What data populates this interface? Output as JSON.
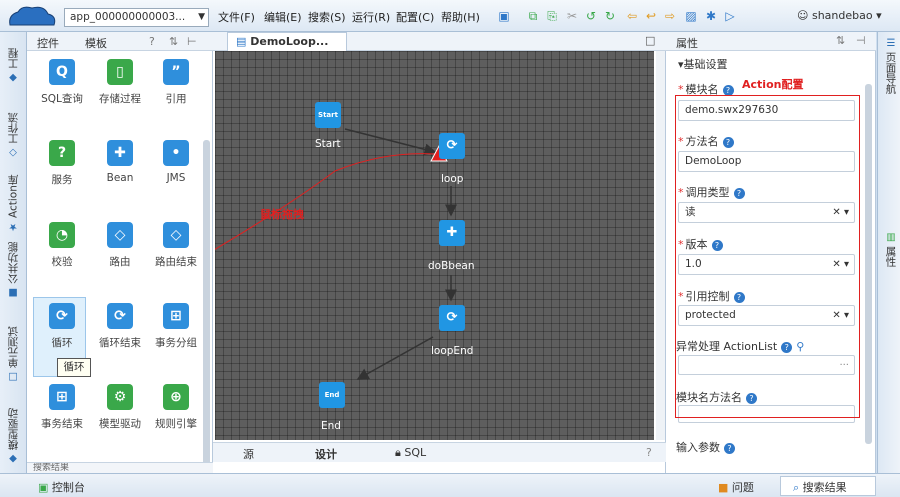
{
  "toolbar": {
    "app_select": "app_000000000003...",
    "menus": [
      "文件(F)",
      "编辑(E)",
      "搜索(S)",
      "运行(R)",
      "配置(C)",
      "帮助(H)"
    ],
    "user": "shandebao"
  },
  "left_strip": {
    "tabs": [
      "工程",
      "工作流",
      "Action库",
      "公共功能",
      "单元测试",
      "模型驱动"
    ]
  },
  "palette": {
    "tabs": [
      "控件",
      "模板"
    ],
    "items": [
      {
        "label": "SQL查询",
        "color": "#2f8fdc",
        "icon": "search-icon"
      },
      {
        "label": "存储过程",
        "color": "#3aa84a",
        "icon": "procedure-icon"
      },
      {
        "label": "引用",
        "color": "#2f8fdc",
        "icon": "quote-icon"
      },
      {
        "label": "服务",
        "color": "#3aa84a",
        "icon": "question-icon"
      },
      {
        "label": "Bean",
        "color": "#2f8fdc",
        "icon": "puzzle-icon"
      },
      {
        "label": "JMS",
        "color": "#2f8fdc",
        "icon": "chat-icon"
      },
      {
        "label": "校验",
        "color": "#3aa84a",
        "icon": "pie-icon"
      },
      {
        "label": "路由",
        "color": "#2f8fdc",
        "icon": "diamond-icon"
      },
      {
        "label": "路由结束",
        "color": "#2f8fdc",
        "icon": "diamond-end-icon"
      },
      {
        "label": "循环",
        "color": "#2f8fdc",
        "icon": "loop-icon"
      },
      {
        "label": "循环结束",
        "color": "#2f8fdc",
        "icon": "loop-end-icon"
      },
      {
        "label": "事务分组",
        "color": "#2f8fdc",
        "icon": "grid-icon"
      },
      {
        "label": "事务结束",
        "color": "#2f8fdc",
        "icon": "grid-end-icon"
      },
      {
        "label": "模型驱动",
        "color": "#3aa84a",
        "icon": "gear-icon"
      },
      {
        "label": "规则引擎",
        "color": "#3aa84a",
        "icon": "rule-icon"
      }
    ],
    "tooltip": "循环",
    "search_results_label": "搜索结果"
  },
  "editor": {
    "tab_title": "DemoLoop...",
    "bottom_tabs": [
      "源",
      "设计",
      "SQL"
    ],
    "nodes": {
      "start_icon": "Start",
      "start_label": "Start",
      "loop_label": "loop",
      "dobbean_label": "doBbean",
      "loopend_label": "loopEnd",
      "end_icon": "End",
      "end_label": "End"
    },
    "annotation": "鼠标拖拽"
  },
  "properties": {
    "title": "属性",
    "section": "基础设置",
    "annotation": "Action配置",
    "module_name_label": "模块名",
    "module_name_value": "demo.swx297630",
    "method_name_label": "方法名",
    "method_name_value": "DemoLoop",
    "call_type_label": "调用类型",
    "call_type_value": "读",
    "version_label": "版本",
    "version_value": "1.0",
    "ref_control_label": "引用控制",
    "ref_control_value": "protected",
    "exception_label": "异常处理 ActionList",
    "module_method_label": "模块名方法名",
    "input_params_label": "输入参数"
  },
  "right_strip": {
    "tabs": [
      "页面导航",
      "属性"
    ]
  },
  "status_bar": {
    "console": "控制台",
    "problems": "问题",
    "search_results": "搜索结果"
  }
}
